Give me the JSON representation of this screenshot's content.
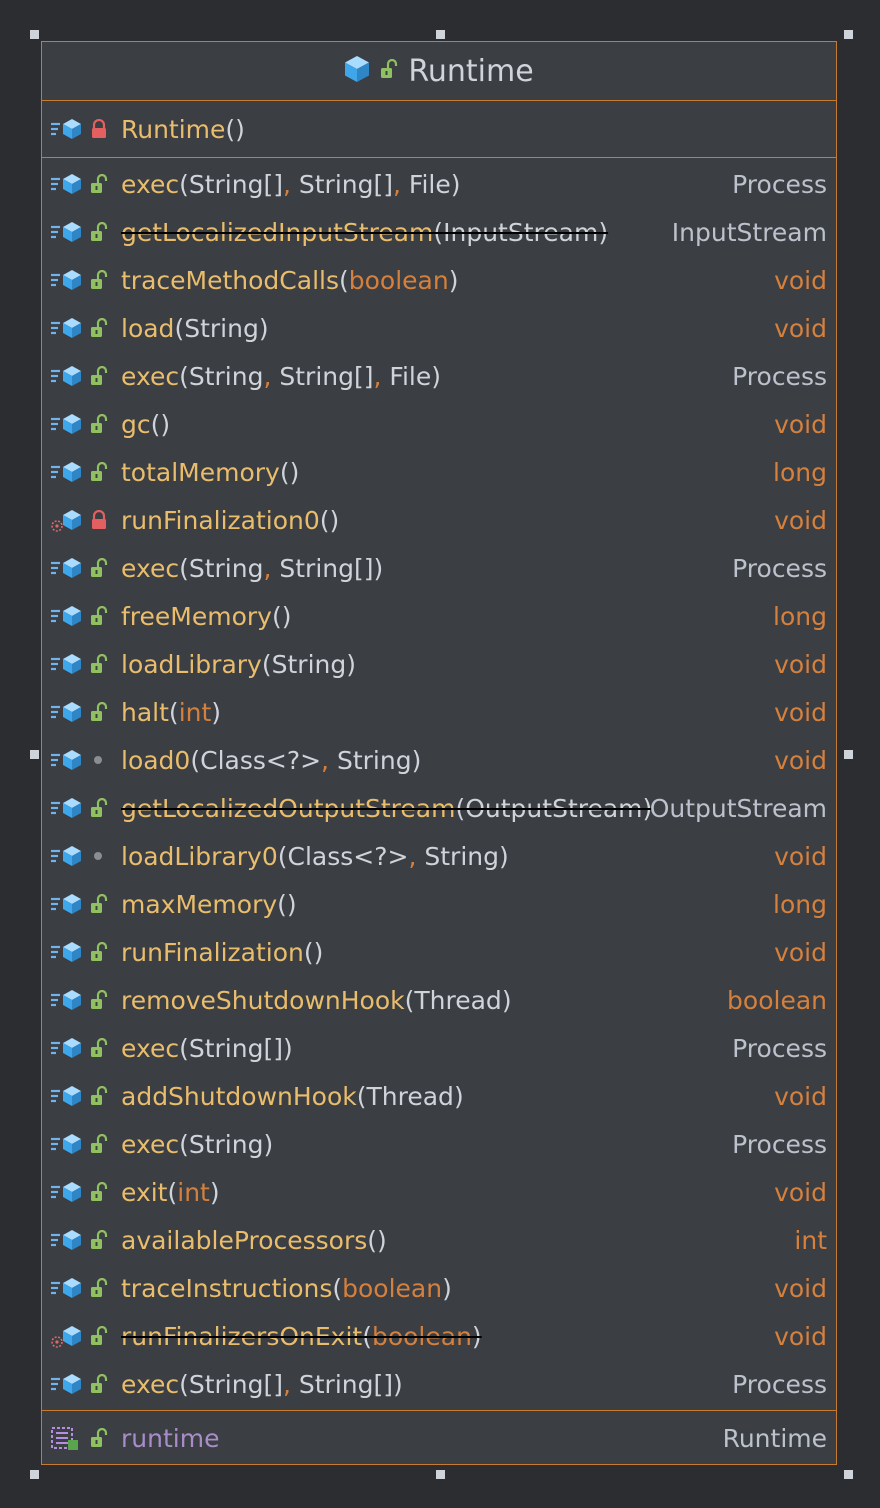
{
  "class_name": "Runtime",
  "colors": {
    "border": "#c77b2e",
    "method_name": "#e9bd6c",
    "keyword": "#d5803d",
    "plain": "#cfd3da",
    "field_name": "#a88dc9",
    "background": "#3b3e43"
  },
  "constructor": {
    "name": "Runtime",
    "params": "()",
    "visibility": "private"
  },
  "methods": [
    {
      "name": "exec",
      "p": [
        [
          "(",
          "p"
        ],
        [
          "String[]",
          "p"
        ],
        [
          ", ",
          "k"
        ],
        [
          "String[]",
          "p"
        ],
        [
          ", ",
          "k"
        ],
        [
          "File",
          "p"
        ],
        [
          ")",
          "p"
        ]
      ],
      "ret": "Process",
      "rk": "obj",
      "vis": "public",
      "icon": "method"
    },
    {
      "name": "getLocalizedInputStream",
      "p": [
        [
          "(",
          "p"
        ],
        [
          "InputStream",
          "p"
        ],
        [
          ")",
          "p"
        ]
      ],
      "ret": "InputStream",
      "rk": "obj",
      "vis": "public",
      "icon": "method",
      "deprecated": true
    },
    {
      "name": "traceMethodCalls",
      "p": [
        [
          "(",
          "p"
        ],
        [
          "boolean",
          "k"
        ],
        [
          ")",
          "p"
        ]
      ],
      "ret": "void",
      "rk": "kw",
      "vis": "public",
      "icon": "method"
    },
    {
      "name": "load",
      "p": [
        [
          "(",
          "p"
        ],
        [
          "String",
          "p"
        ],
        [
          ")",
          "p"
        ]
      ],
      "ret": "void",
      "rk": "kw",
      "vis": "public",
      "icon": "method"
    },
    {
      "name": "exec",
      "p": [
        [
          "(",
          "p"
        ],
        [
          "String",
          "p"
        ],
        [
          ", ",
          "k"
        ],
        [
          "String[]",
          "p"
        ],
        [
          ", ",
          "k"
        ],
        [
          "File",
          "p"
        ],
        [
          ")",
          "p"
        ]
      ],
      "ret": "Process",
      "rk": "obj",
      "vis": "public",
      "icon": "method"
    },
    {
      "name": "gc",
      "p": [
        [
          "()",
          "p"
        ]
      ],
      "ret": "void",
      "rk": "kw",
      "vis": "public",
      "icon": "method"
    },
    {
      "name": "totalMemory",
      "p": [
        [
          "()",
          "p"
        ]
      ],
      "ret": "long",
      "rk": "kw",
      "vis": "public",
      "icon": "method"
    },
    {
      "name": "runFinalization0",
      "p": [
        [
          "()",
          "p"
        ]
      ],
      "ret": "void",
      "rk": "kw",
      "vis": "private",
      "icon": "static-method"
    },
    {
      "name": "exec",
      "p": [
        [
          "(",
          "p"
        ],
        [
          "String",
          "p"
        ],
        [
          ", ",
          "k"
        ],
        [
          "String[]",
          "p"
        ],
        [
          ")",
          "p"
        ]
      ],
      "ret": "Process",
      "rk": "obj",
      "vis": "public",
      "icon": "method"
    },
    {
      "name": "freeMemory",
      "p": [
        [
          "()",
          "p"
        ]
      ],
      "ret": "long",
      "rk": "kw",
      "vis": "public",
      "icon": "method"
    },
    {
      "name": "loadLibrary",
      "p": [
        [
          "(",
          "p"
        ],
        [
          "String",
          "p"
        ],
        [
          ")",
          "p"
        ]
      ],
      "ret": "void",
      "rk": "kw",
      "vis": "public",
      "icon": "method"
    },
    {
      "name": "halt",
      "p": [
        [
          "(",
          "p"
        ],
        [
          "int",
          "k"
        ],
        [
          ")",
          "p"
        ]
      ],
      "ret": "void",
      "rk": "kw",
      "vis": "public",
      "icon": "method"
    },
    {
      "name": "load0",
      "p": [
        [
          "(",
          "p"
        ],
        [
          "Class<?>",
          "p"
        ],
        [
          ", ",
          "k"
        ],
        [
          "String",
          "p"
        ],
        [
          ")",
          "p"
        ]
      ],
      "ret": "void",
      "rk": "kw",
      "vis": "package",
      "icon": "method"
    },
    {
      "name": "getLocalizedOutputStream",
      "p": [
        [
          "(",
          "p"
        ],
        [
          "OutputStream",
          "p"
        ],
        [
          ")",
          "p"
        ]
      ],
      "ret": "OutputStream",
      "rk": "obj",
      "vis": "public",
      "icon": "method",
      "deprecated": true
    },
    {
      "name": "loadLibrary0",
      "p": [
        [
          "(",
          "p"
        ],
        [
          "Class<?>",
          "p"
        ],
        [
          ", ",
          "k"
        ],
        [
          "String",
          "p"
        ],
        [
          ")",
          "p"
        ]
      ],
      "ret": "void",
      "rk": "kw",
      "vis": "package",
      "icon": "method"
    },
    {
      "name": "maxMemory",
      "p": [
        [
          "()",
          "p"
        ]
      ],
      "ret": "long",
      "rk": "kw",
      "vis": "public",
      "icon": "method"
    },
    {
      "name": "runFinalization",
      "p": [
        [
          "()",
          "p"
        ]
      ],
      "ret": "void",
      "rk": "kw",
      "vis": "public",
      "icon": "method"
    },
    {
      "name": "removeShutdownHook",
      "p": [
        [
          "(",
          "p"
        ],
        [
          "Thread",
          "p"
        ],
        [
          ")",
          "p"
        ]
      ],
      "ret": "boolean",
      "rk": "kw",
      "vis": "public",
      "icon": "method"
    },
    {
      "name": "exec",
      "p": [
        [
          "(",
          "p"
        ],
        [
          "String[]",
          "p"
        ],
        [
          ")",
          "p"
        ]
      ],
      "ret": "Process",
      "rk": "obj",
      "vis": "public",
      "icon": "method"
    },
    {
      "name": "addShutdownHook",
      "p": [
        [
          "(",
          "p"
        ],
        [
          "Thread",
          "p"
        ],
        [
          ")",
          "p"
        ]
      ],
      "ret": "void",
      "rk": "kw",
      "vis": "public",
      "icon": "method"
    },
    {
      "name": "exec",
      "p": [
        [
          "(",
          "p"
        ],
        [
          "String",
          "p"
        ],
        [
          ")",
          "p"
        ]
      ],
      "ret": "Process",
      "rk": "obj",
      "vis": "public",
      "icon": "method"
    },
    {
      "name": "exit",
      "p": [
        [
          "(",
          "p"
        ],
        [
          "int",
          "k"
        ],
        [
          ")",
          "p"
        ]
      ],
      "ret": "void",
      "rk": "kw",
      "vis": "public",
      "icon": "method"
    },
    {
      "name": "availableProcessors",
      "p": [
        [
          "()",
          "p"
        ]
      ],
      "ret": "int",
      "rk": "kw",
      "vis": "public",
      "icon": "method"
    },
    {
      "name": "traceInstructions",
      "p": [
        [
          "(",
          "p"
        ],
        [
          "boolean",
          "k"
        ],
        [
          ")",
          "p"
        ]
      ],
      "ret": "void",
      "rk": "kw",
      "vis": "public",
      "icon": "method"
    },
    {
      "name": "runFinalizersOnExit",
      "p": [
        [
          "(",
          "p"
        ],
        [
          "boolean",
          "k"
        ],
        [
          ")",
          "p"
        ]
      ],
      "ret": "void",
      "rk": "kw",
      "vis": "public",
      "icon": "static-method",
      "deprecated": true
    },
    {
      "name": "exec",
      "p": [
        [
          "(",
          "p"
        ],
        [
          "String[]",
          "p"
        ],
        [
          ", ",
          "k"
        ],
        [
          "String[]",
          "p"
        ],
        [
          ")",
          "p"
        ]
      ],
      "ret": "Process",
      "rk": "obj",
      "vis": "public",
      "icon": "method"
    }
  ],
  "fields": [
    {
      "name": "runtime",
      "type": "Runtime",
      "vis": "public",
      "icon": "field"
    }
  ]
}
